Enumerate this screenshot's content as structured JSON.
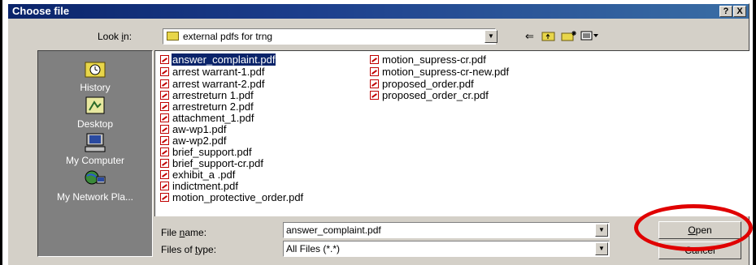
{
  "dialog": {
    "title": "Choose file",
    "help_button": "?",
    "close_button": "X"
  },
  "look_in": {
    "label_pre": "Look ",
    "label_u": "i",
    "label_post": "n:",
    "value": "external pdfs for trng"
  },
  "places": [
    {
      "label": "History",
      "icon": "history-icon"
    },
    {
      "label": "Desktop",
      "icon": "desktop-icon"
    },
    {
      "label": "My Computer",
      "icon": "my-computer-icon"
    },
    {
      "label": "My Network Pla...",
      "icon": "network-places-icon"
    }
  ],
  "files_col1": [
    "answer_complaint.pdf",
    "arrest warrant-1.pdf",
    "arrest warrant-2.pdf",
    "arrestreturn 1.pdf",
    "arrestreturn 2.pdf",
    "attachment_1.pdf",
    "aw-wp1.pdf",
    "aw-wp2.pdf",
    "brief_support.pdf",
    "brief_support-cr.pdf",
    "exhibit_a .pdf",
    "indictment.pdf",
    "motion_protective_order.pdf"
  ],
  "files_col2": [
    "motion_supress-cr.pdf",
    "motion_supress-cr-new.pdf",
    "proposed_order.pdf",
    "proposed_order_cr.pdf"
  ],
  "selected_file": "answer_complaint.pdf",
  "file_name": {
    "label_pre": "File ",
    "label_u": "n",
    "label_post": "ame:",
    "value": "answer_complaint.pdf"
  },
  "file_type": {
    "label_pre": "Files of ",
    "label_u": "t",
    "label_post": "ype:",
    "value": "All Files (*.*)"
  },
  "buttons": {
    "open_u": "O",
    "open_rest": "pen",
    "cancel": "Cancel"
  },
  "annotation": {
    "color": "#e00000"
  }
}
